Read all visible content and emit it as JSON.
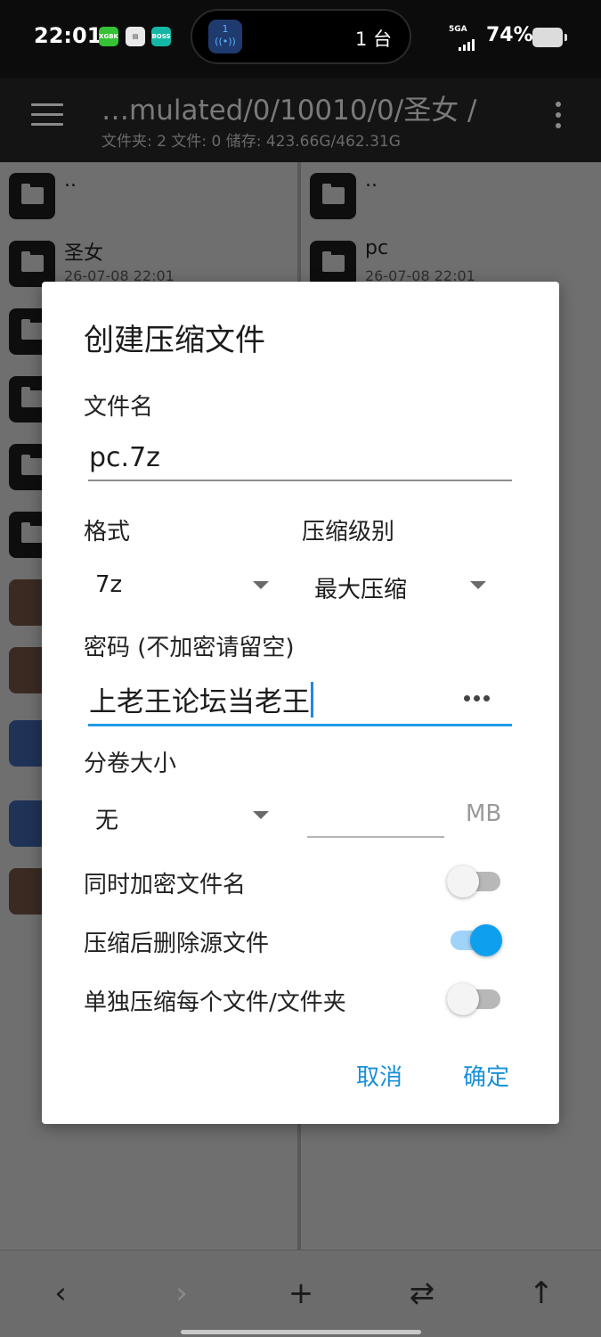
{
  "status_bar": {
    "time": "22:01",
    "app_icons": [
      {
        "name": "xgbk-app-icon",
        "label": "XGBK",
        "color": "#35c235"
      },
      {
        "name": "mi-app-icon",
        "label": "",
        "color": "#e9e9e9"
      },
      {
        "name": "boss-app-icon",
        "label": "BOSS",
        "color": "#14b7a6"
      }
    ],
    "island_text": "1 台",
    "network": "5GA",
    "battery": "74%"
  },
  "app_bar": {
    "path": "…mulated/0/10010/0/圣女 /",
    "info": "文件夹: 2  文件: 0  储存: 423.66G/462.31G"
  },
  "left_pane": {
    "rows": [
      {
        "name": "..",
        "date": ""
      },
      {
        "name": "圣女",
        "date": "26-07-08 22:01"
      }
    ]
  },
  "right_pane": {
    "rows": [
      {
        "name": "..",
        "date": ""
      },
      {
        "name": "pc",
        "date": "26-07-08 22:01"
      }
    ]
  },
  "dialog": {
    "title": "创建压缩文件",
    "filename_label": "文件名",
    "filename_value": "pc.7z",
    "format_label": "格式",
    "format_value": "7z",
    "level_label": "压缩级别",
    "level_value": "最大压缩",
    "password_label": "密码 (不加密请留空)",
    "password_value": "上老王论坛当老王",
    "split_label": "分卷大小",
    "split_value": "无",
    "split_unit": "MB",
    "split_size_value": "",
    "encrypt_names_label": "同时加密文件名",
    "encrypt_names_on": false,
    "delete_source_label": "压缩后删除源文件",
    "delete_source_on": true,
    "separate_label": "单独压缩每个文件/文件夹",
    "separate_on": false,
    "cancel_label": "取消",
    "ok_label": "确定",
    "accent_color": "#1a90d8"
  }
}
